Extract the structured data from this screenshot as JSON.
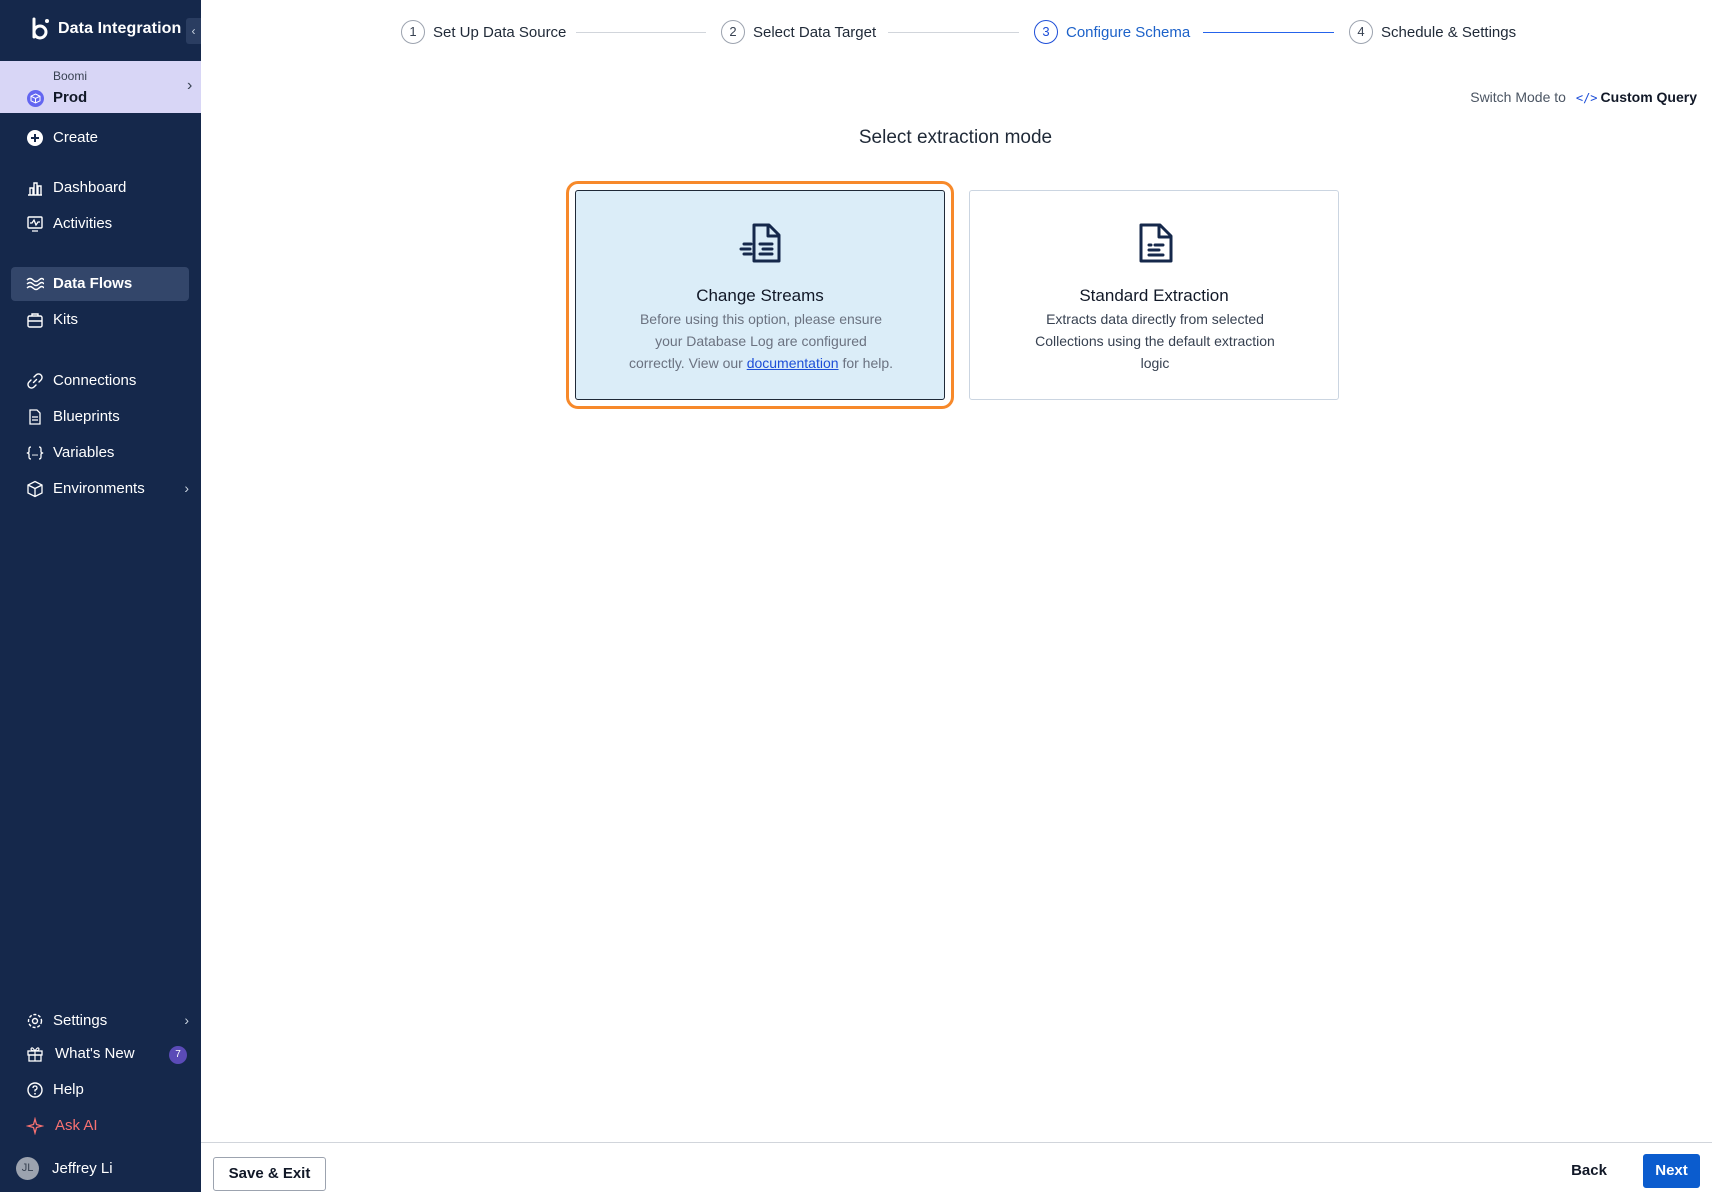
{
  "app": {
    "title": "Data Integration"
  },
  "environment": {
    "org": "Boomi",
    "name": "Prod"
  },
  "sidebar": {
    "items": [
      {
        "label": "Create",
        "icon": "plus-circle-icon"
      },
      {
        "label": "Dashboard",
        "icon": "bar-chart-icon"
      },
      {
        "label": "Activities",
        "icon": "monitor-activity-icon"
      },
      {
        "label": "Data Flows",
        "icon": "waves-icon",
        "active": true
      },
      {
        "label": "Kits",
        "icon": "briefcase-icon"
      },
      {
        "label": "Connections",
        "icon": "link-icon"
      },
      {
        "label": "Blueprints",
        "icon": "document-icon"
      },
      {
        "label": "Variables",
        "icon": "braces-icon"
      },
      {
        "label": "Environments",
        "icon": "cube-icon"
      }
    ],
    "bottom_items": [
      {
        "label": "Settings",
        "icon": "gear-icon"
      },
      {
        "label": "What's New",
        "icon": "gift-icon",
        "badge": "7"
      },
      {
        "label": "Help",
        "icon": "help-circle-icon"
      },
      {
        "label": "Ask AI",
        "icon": "sparkle-icon"
      }
    ],
    "user": {
      "initials": "JL",
      "name": "Jeffrey Li"
    }
  },
  "stepper": {
    "steps": [
      {
        "num": "1",
        "label": "Set Up Data Source"
      },
      {
        "num": "2",
        "label": "Select Data Target"
      },
      {
        "num": "3",
        "label": "Configure Schema",
        "current": true
      },
      {
        "num": "4",
        "label": "Schedule & Settings"
      }
    ]
  },
  "switch_mode": {
    "prefix": "Switch Mode to",
    "link": "Custom Query"
  },
  "main": {
    "title": "Select extraction mode",
    "cards": [
      {
        "title": "Change Streams",
        "desc_before": "Before using this option, please ensure your Database Log are configured correctly. View our",
        "link": "documentation",
        "desc_after": "for help.",
        "selected": true
      },
      {
        "title": "Standard Extraction",
        "desc": "Extracts data directly from selected Collections using the default extraction logic"
      }
    ]
  },
  "footer": {
    "save_exit": "Save & Exit",
    "back": "Back",
    "next": "Next"
  },
  "colors": {
    "sidebar_bg": "#15284b",
    "accent": "#0b5cce",
    "highlight": "#f7892a",
    "selected_card_bg": "#dbedf8"
  }
}
